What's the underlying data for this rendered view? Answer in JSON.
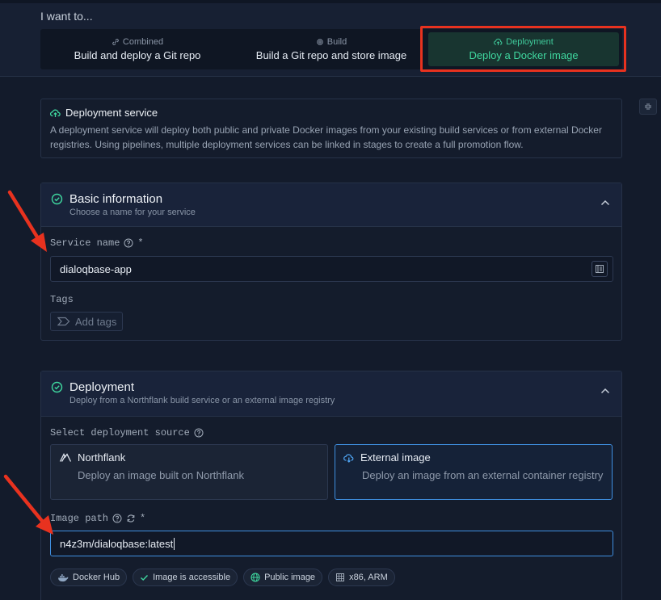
{
  "header": {
    "i_want_label": "I want to...",
    "options": [
      {
        "caption": "Combined",
        "label": "Build and deploy a Git repo"
      },
      {
        "caption": "Build",
        "label": "Build a Git repo and store image"
      },
      {
        "caption": "Deployment",
        "label": "Deploy a Docker image",
        "selected": true
      }
    ]
  },
  "info": {
    "title": "Deployment service",
    "text": "A deployment service will deploy both public and private Docker images from your existing build services or from external Docker registries. Using pipelines, multiple deployment services can be linked in stages to create a full promotion flow."
  },
  "basic": {
    "title": "Basic information",
    "subtitle": "Choose a name for your service",
    "service_name_label": "Service name",
    "required_mark": "*",
    "service_name_value": "dialoqbase-app",
    "tags_label": "Tags",
    "add_tags_label": "Add tags"
  },
  "deployment": {
    "title": "Deployment",
    "subtitle": "Deploy from a Northflank build service or an external image registry",
    "source_label": "Select deployment source",
    "sources": [
      {
        "title": "Northflank",
        "desc": "Deploy an image built on Northflank"
      },
      {
        "title": "External image",
        "desc": "Deploy an image from an external container registry",
        "selected": true
      }
    ],
    "image_path_label": "Image path",
    "required_mark": "*",
    "image_path_value": "n4z3m/dialoqbase:latest",
    "chips": [
      "Docker Hub",
      "Image is accessible",
      "Public image",
      "x86, ARM"
    ]
  },
  "colors": {
    "accent_green": "#3fd79f",
    "accent_blue": "#3f8fe0",
    "highlight_red": "#e8321f",
    "background": "#131b2b"
  }
}
